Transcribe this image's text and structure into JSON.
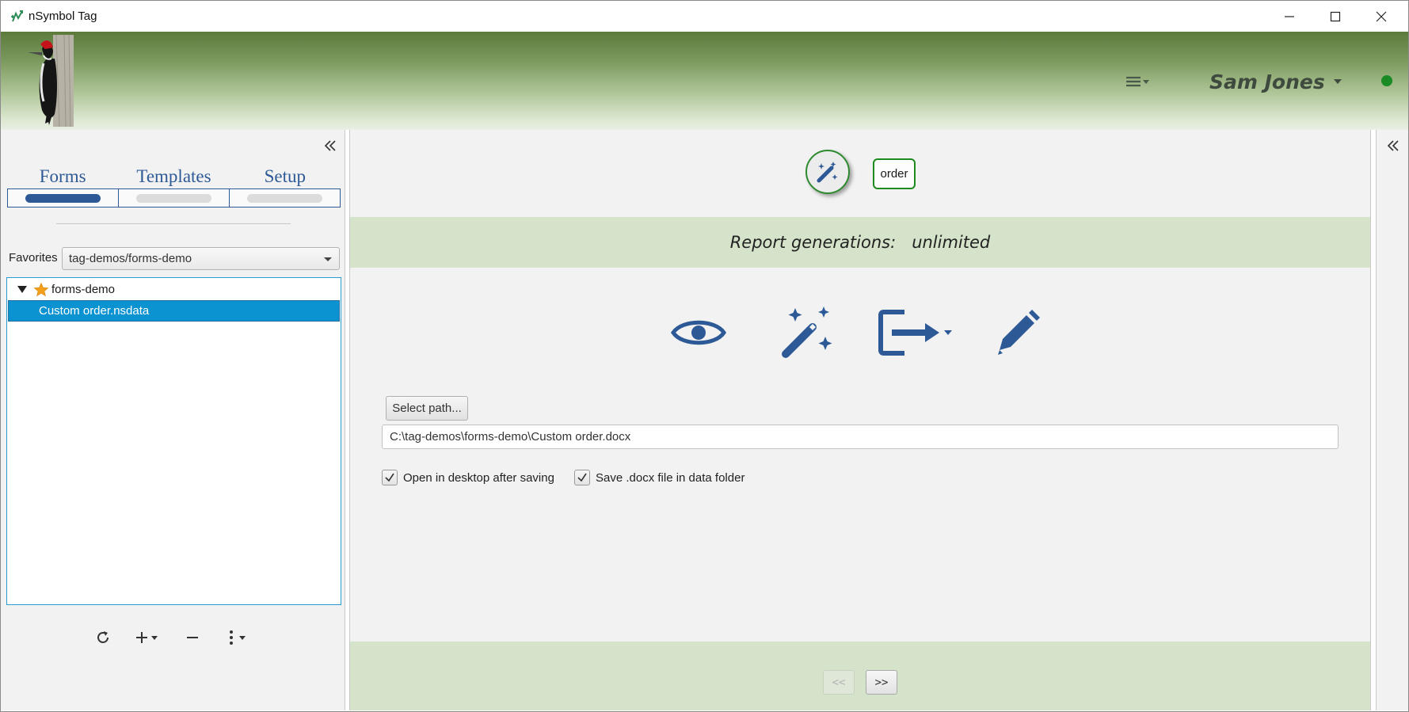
{
  "window": {
    "title": "nSymbol Tag",
    "controls": [
      "minimize-icon",
      "maximize-icon",
      "close-icon"
    ]
  },
  "header": {
    "logo": "woodpecker-logo",
    "user_name": "Sam Jones",
    "status_color": "#1a8a24"
  },
  "sidebar": {
    "tabs": [
      {
        "label": "Forms",
        "active": true
      },
      {
        "label": "Templates",
        "active": false
      },
      {
        "label": "Setup",
        "active": false
      }
    ],
    "favorites_label": "Favorites",
    "favorites_value": "tag-demos/forms-demo",
    "tree": {
      "root": "forms-demo",
      "selected_item": "Custom order.nsdata"
    },
    "tools": [
      "refresh-icon",
      "add-icon",
      "remove-icon",
      "more-icon"
    ]
  },
  "main": {
    "order_button": "order",
    "report_label": "Report generations:",
    "report_value": "unlimited",
    "actions": [
      "preview-icon",
      "generate-wand-icon",
      "export-icon",
      "edit-pencil-icon"
    ],
    "select_path_label": "Select path...",
    "path_value": "C:\\tag-demos\\forms-demo\\Custom order.docx",
    "options": [
      {
        "label": "Open in desktop after saving",
        "checked": true
      },
      {
        "label": "Save .docx file in data folder",
        "checked": true
      }
    ],
    "nav": {
      "prev": "<<",
      "next": ">>"
    }
  },
  "colors": {
    "accent_blue": "#2d5a96",
    "accent_green": "#2f8a2f",
    "band_green": "#d4e3c9",
    "selection_blue": "#0a93d0"
  }
}
